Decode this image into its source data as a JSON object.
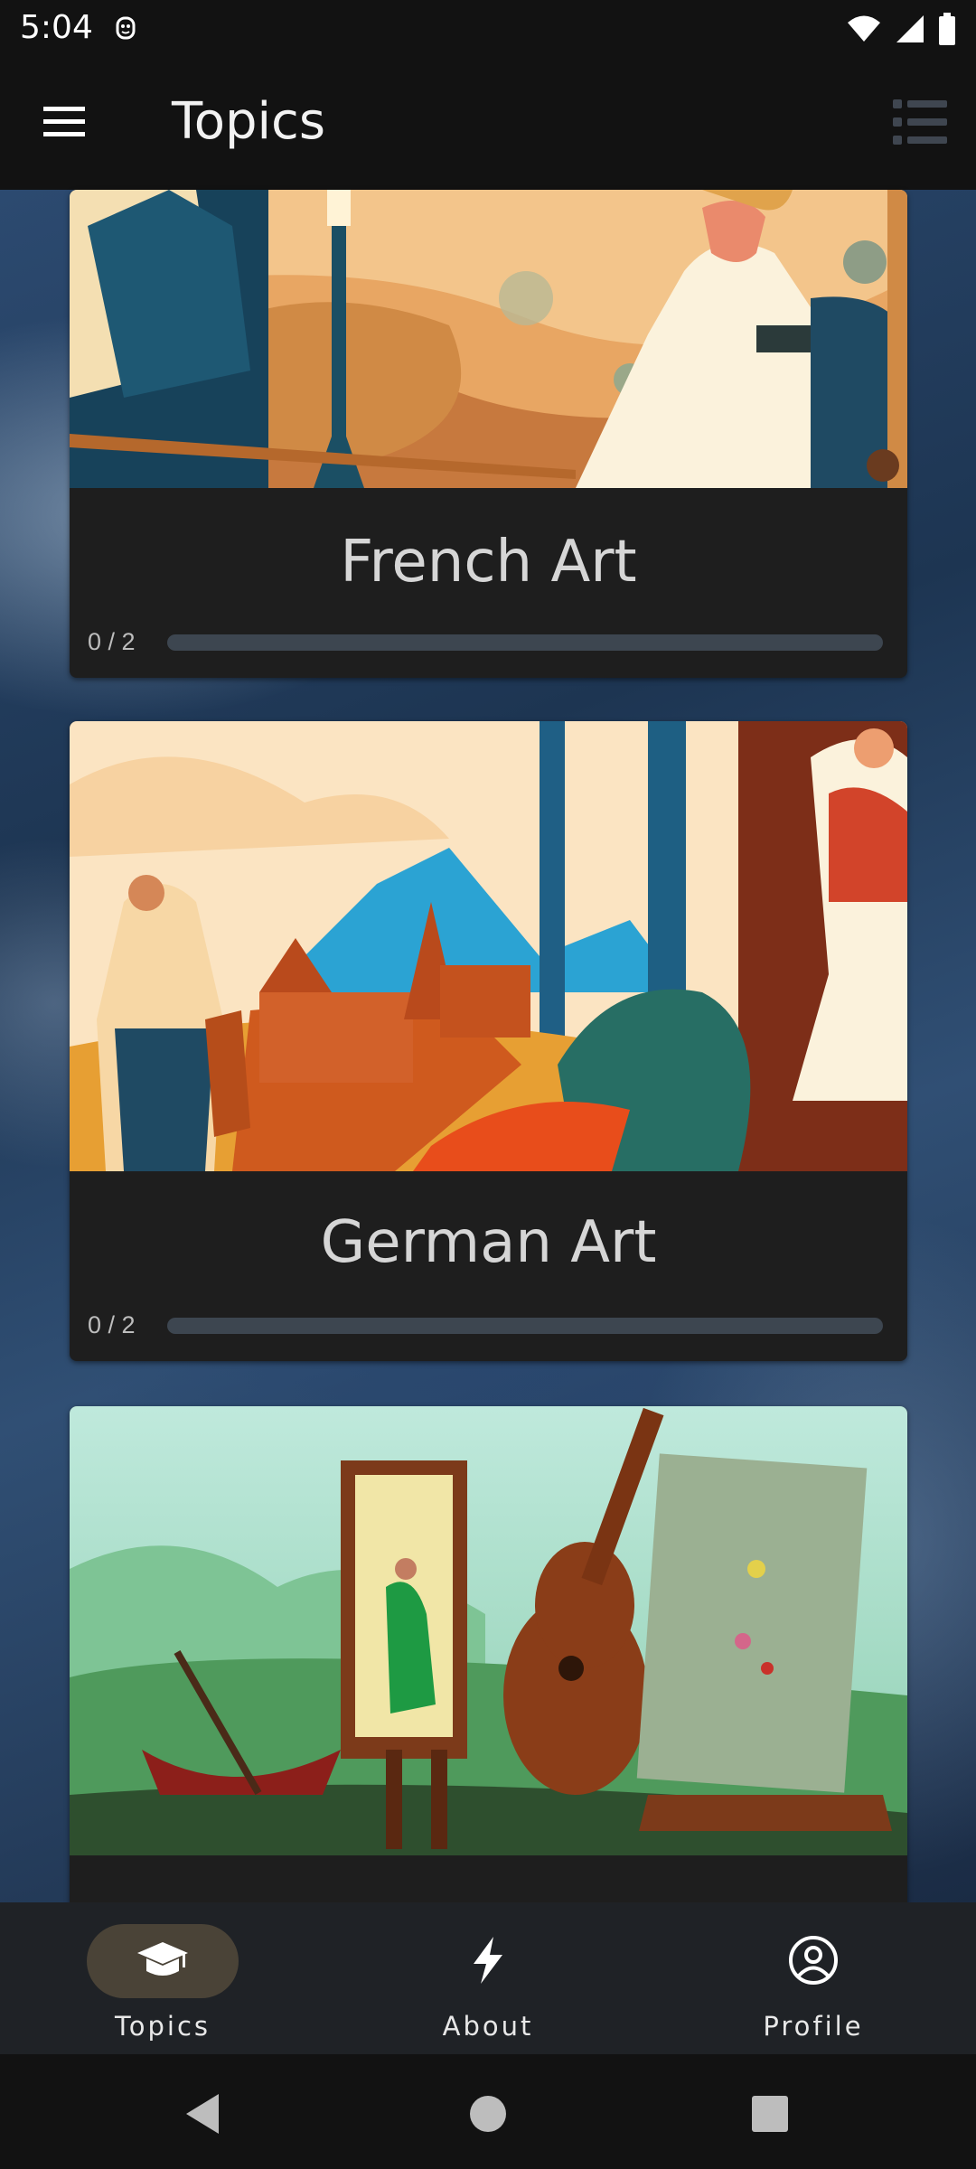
{
  "status_bar": {
    "time": "5:04",
    "icons": [
      "face-id-icon",
      "wifi-icon",
      "signal-icon",
      "battery-icon"
    ]
  },
  "app_bar": {
    "title": "Topics",
    "menu_icon": "hamburger-menu-icon",
    "action_icon": "list-view-icon"
  },
  "topics": [
    {
      "name": "French Art",
      "progress_text": "0 / 2",
      "progress": 0
    },
    {
      "name": "German Art",
      "progress_text": "0 / 2",
      "progress": 0
    },
    {
      "name": "",
      "progress_text": "",
      "progress": 0
    }
  ],
  "bottom_nav": {
    "items": [
      {
        "label": "Topics",
        "icon": "graduation-cap-icon",
        "active": true
      },
      {
        "label": "About",
        "icon": "lightning-bolt-icon",
        "active": false
      },
      {
        "label": "Profile",
        "icon": "profile-circle-icon",
        "active": false
      }
    ]
  },
  "system_nav": [
    "back-icon",
    "home-icon",
    "recents-icon"
  ],
  "colors": {
    "bar_background": "#121212",
    "card_background": "#1e1e1e",
    "nav_background": "#1f2226",
    "active_pill": "#4a4337",
    "progress_track": "#3d4650"
  }
}
